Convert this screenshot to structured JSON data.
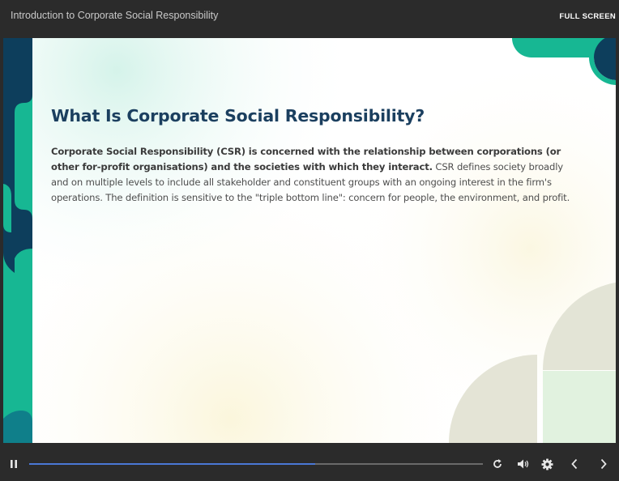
{
  "header": {
    "course_title": "Introduction to Corporate Social Responsibility",
    "fullscreen_label": "FULL SCREEN"
  },
  "slide": {
    "heading": "What Is Corporate Social Responsibility?",
    "body_bold": "Corporate Social Responsibility (CSR) is concerned with the relationship between corporations (or other for-profit organisations) and the societies with which they interact.",
    "body_regular": " CSR defines society broadly and on multiple levels to include all stakeholder and constituent groups with an ongoing interest in the firm's operations. The definition is sensitive to the \"triple bottom line\": concern for people, the environment, and profit."
  },
  "controls": {
    "play_state": "playing",
    "progress": 0.63,
    "icons": [
      "pause-icon",
      "replay-icon",
      "volume-icon",
      "settings-icon",
      "previous-icon",
      "next-icon"
    ]
  },
  "colors": {
    "chrome": "#2b2b2b",
    "heading": "#1b3f5f",
    "teal": "#19b994",
    "navy": "#0d3e5c",
    "progress": "#4a78d6"
  }
}
